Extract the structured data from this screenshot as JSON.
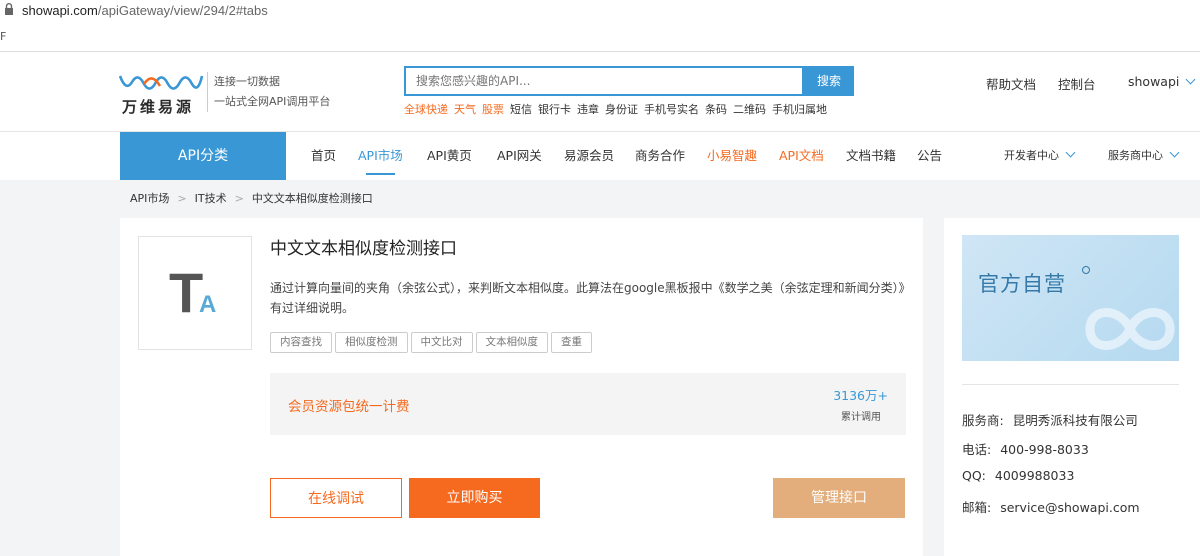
{
  "browser": {
    "url_host": "showapi.com",
    "url_path": "/apiGateway/view/294/2#tabs",
    "bookmark_fragment": "F"
  },
  "header": {
    "brand_name": "万维易源",
    "slogan_line1": "连接一切数据",
    "slogan_line2": "一站式全网API调用平台",
    "search": {
      "placeholder": "搜索您感兴趣的API...",
      "button_label": "搜索"
    },
    "hotwords": [
      {
        "label": "全球快递",
        "hot": true
      },
      {
        "label": "天气",
        "hot": true
      },
      {
        "label": "股票",
        "hot": true
      },
      {
        "label": "短信",
        "hot": false
      },
      {
        "label": "银行卡",
        "hot": false
      },
      {
        "label": "违章",
        "hot": false
      },
      {
        "label": "身份证",
        "hot": false
      },
      {
        "label": "手机号实名",
        "hot": false
      },
      {
        "label": "条码",
        "hot": false
      },
      {
        "label": "二维码",
        "hot": false
      },
      {
        "label": "手机归属地",
        "hot": false
      }
    ],
    "help_docs": "帮助文档",
    "console": "控制台",
    "username": "showapi"
  },
  "nav": {
    "category": "API分类",
    "items": [
      {
        "label": "首页"
      },
      {
        "label": "API市场"
      },
      {
        "label": "API黄页"
      },
      {
        "label": "API网关"
      },
      {
        "label": "易源会员"
      },
      {
        "label": "商务合作"
      },
      {
        "label": "小易智趣"
      },
      {
        "label": "API文档"
      },
      {
        "label": "文档书籍"
      },
      {
        "label": "公告"
      }
    ],
    "developer_center": "开发者中心",
    "provider_center": "服务商中心"
  },
  "breadcrumb": {
    "items": [
      "API市场",
      "IT技术",
      "中文文本相似度检测接口"
    ],
    "separator": ">"
  },
  "api": {
    "icon_letter_main": "T",
    "icon_letter_sub": "A",
    "title": "中文文本相似度检测接口",
    "description": "通过计算向量间的夹角（余弦公式），来判断文本相似度。此算法在google黑板报中《数学之美（余弦定理和新闻分类）》有过详细说明。",
    "tags": [
      "内容查找",
      "相似度检测",
      "中文比对",
      "文本相似度",
      "查重"
    ],
    "pricing_text": "会员资源包统一计费",
    "call_count": "3136万+",
    "call_count_label": "累计调用",
    "buttons": {
      "online_test": "在线调试",
      "buy_now": "立即购买",
      "manage": "管理接口"
    }
  },
  "sidebar": {
    "banner_text": "官方自营",
    "provider_label": "服务商:",
    "provider": "昆明秀派科技有限公司",
    "phone_label": "电话:",
    "phone": "400-998-8033",
    "qq_label": "QQ:",
    "qq": "4009988033",
    "email_label": "邮箱:",
    "email": "service@showapi.com"
  },
  "colors": {
    "accent_blue": "#3a97d6",
    "accent_orange": "#f56a1f",
    "manage_button": "#e3ad7c"
  }
}
